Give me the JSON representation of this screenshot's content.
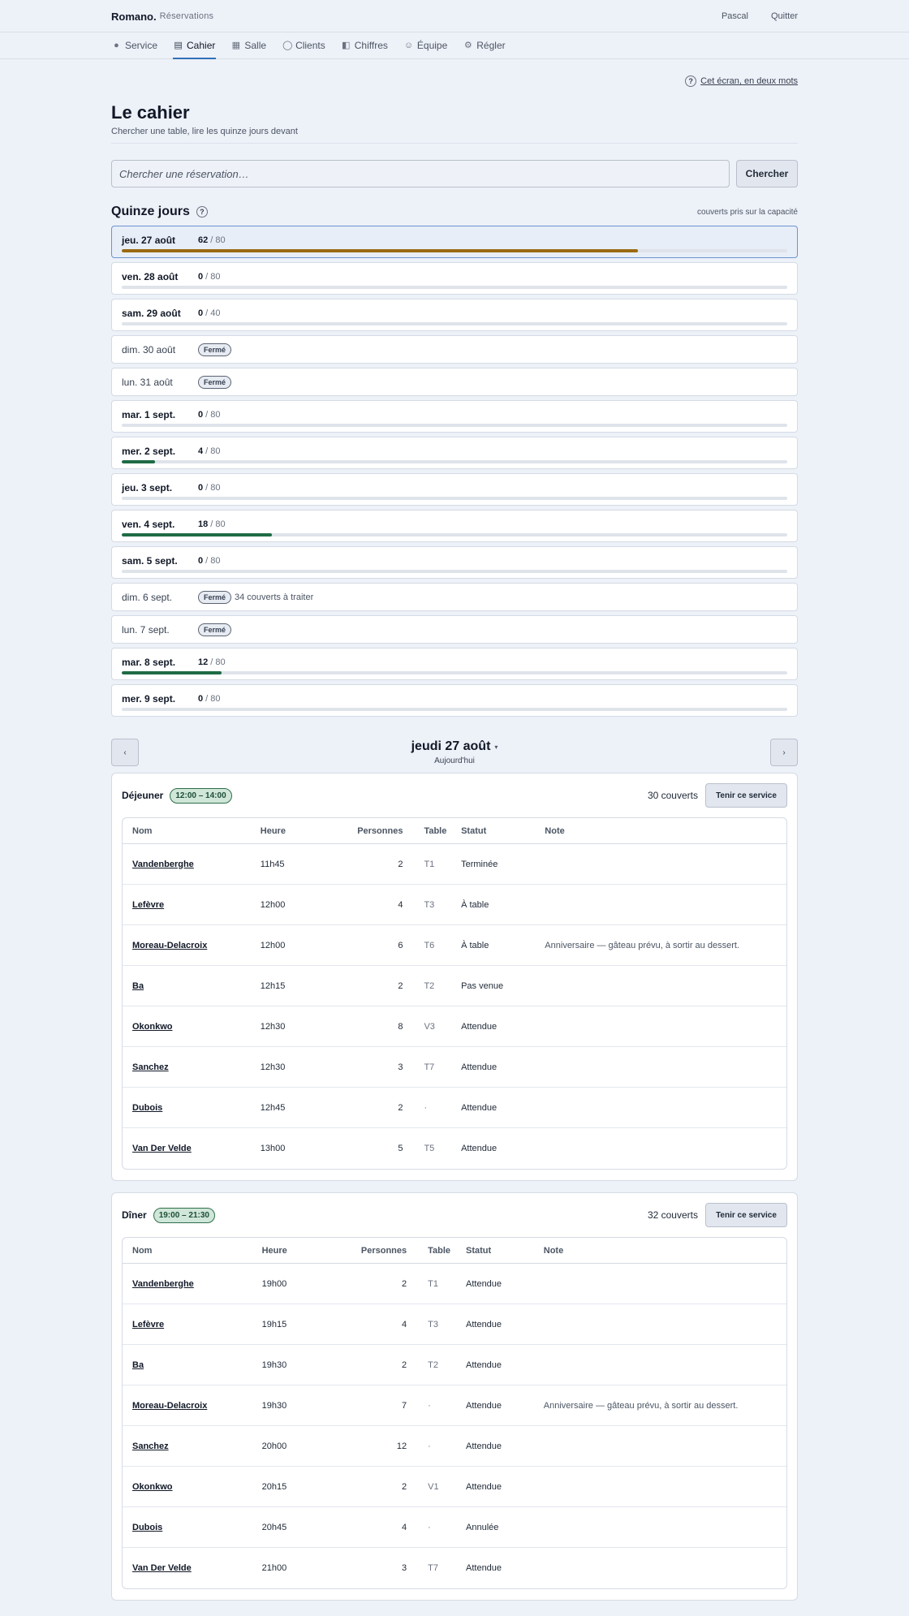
{
  "header": {
    "brand": "Romano.",
    "subtitle": "Réservations",
    "user": "Pascal",
    "logout": "Quitter"
  },
  "nav": [
    {
      "label": "Service",
      "icon": "dot-icon",
      "glyph": "●"
    },
    {
      "label": "Cahier",
      "icon": "book-icon",
      "glyph": "▤"
    },
    {
      "label": "Salle",
      "icon": "grid-icon",
      "glyph": "▦"
    },
    {
      "label": "Clients",
      "icon": "person-icon",
      "glyph": "◯"
    },
    {
      "label": "Chiffres",
      "icon": "chart-icon",
      "glyph": "◧"
    },
    {
      "label": "Équipe",
      "icon": "smile-icon",
      "glyph": "☺"
    },
    {
      "label": "Régler",
      "icon": "gear-icon",
      "glyph": "⚙"
    }
  ],
  "help": {
    "glyph": "?",
    "label": "Cet écran, en deux mots"
  },
  "page": {
    "title": "Le cahier",
    "subtitle": "Chercher une table, lire les quinze jours devant"
  },
  "search": {
    "placeholder": "Chercher une réservation…",
    "value": "",
    "button": "Chercher"
  },
  "fortnight": {
    "title": "Quinze jours",
    "help_glyph": "?",
    "note": "couverts pris sur la capacité",
    "closed_label": "Fermé",
    "days": [
      {
        "label": "jeu. 27 août",
        "covers": 62,
        "capacity": 80,
        "selected": true,
        "color": "#9a6a12"
      },
      {
        "label": "ven. 28 août",
        "covers": 0,
        "capacity": 80
      },
      {
        "label": "sam. 29 août",
        "covers": 0,
        "capacity": 40
      },
      {
        "label": "dim. 30 août",
        "closed": true
      },
      {
        "label": "lun. 31 août",
        "closed": true
      },
      {
        "label": "mar. 1 sept.",
        "covers": 0,
        "capacity": 80
      },
      {
        "label": "mer. 2 sept.",
        "covers": 4,
        "capacity": 80,
        "color": "#1f6b45"
      },
      {
        "label": "jeu. 3 sept.",
        "covers": 0,
        "capacity": 80
      },
      {
        "label": "ven. 4 sept.",
        "covers": 18,
        "capacity": 80,
        "color": "#1f6b45"
      },
      {
        "label": "sam. 5 sept.",
        "covers": 0,
        "capacity": 80
      },
      {
        "label": "dim. 6 sept.",
        "closed": true,
        "extra": "34 couverts à traiter"
      },
      {
        "label": "lun. 7 sept.",
        "closed": true
      },
      {
        "label": "mar. 8 sept.",
        "covers": 12,
        "capacity": 80,
        "color": "#1f6b45"
      },
      {
        "label": "mer. 9 sept.",
        "covers": 0,
        "capacity": 80
      }
    ]
  },
  "date_nav": {
    "prev": "‹",
    "next": "›",
    "title": "jeudi 27 août",
    "caret": "▾",
    "sub": "Aujourd'hui"
  },
  "columns": {
    "name": "Nom",
    "time": "Heure",
    "people": "Personnes",
    "table": "Table",
    "status": "Statut",
    "note": "Note"
  },
  "services": [
    {
      "name": "Déjeuner",
      "hours": "12:00 – 14:00",
      "covers": "30 couverts",
      "button": "Tenir ce service",
      "rows": [
        {
          "name": "Vandenberghe",
          "time": "11h45",
          "people": "2",
          "table": "T1",
          "status": "Terminée",
          "note": ""
        },
        {
          "name": "Lefèvre",
          "time": "12h00",
          "people": "4",
          "table": "T3",
          "status": "À table",
          "note": ""
        },
        {
          "name": "Moreau-Delacroix",
          "time": "12h00",
          "people": "6",
          "table": "T6",
          "status": "À table",
          "note": "Anniversaire — gâteau prévu, à sortir au dessert."
        },
        {
          "name": "Ba",
          "time": "12h15",
          "people": "2",
          "table": "T2",
          "status": "Pas venue",
          "note": ""
        },
        {
          "name": "Okonkwo",
          "time": "12h30",
          "people": "8",
          "table": "V3",
          "status": "Attendue",
          "note": ""
        },
        {
          "name": "Sanchez",
          "time": "12h30",
          "people": "3",
          "table": "T7",
          "status": "Attendue",
          "note": ""
        },
        {
          "name": "Dubois",
          "time": "12h45",
          "people": "2",
          "table": "·",
          "status": "Attendue",
          "note": ""
        },
        {
          "name": "Van Der Velde",
          "time": "13h00",
          "people": "5",
          "table": "T5",
          "status": "Attendue",
          "note": ""
        }
      ]
    },
    {
      "name": "Dîner",
      "hours": "19:00 – 21:30",
      "covers": "32 couverts",
      "button": "Tenir ce service",
      "rows": [
        {
          "name": "Vandenberghe",
          "time": "19h00",
          "people": "2",
          "table": "T1",
          "status": "Attendue",
          "note": ""
        },
        {
          "name": "Lefèvre",
          "time": "19h15",
          "people": "4",
          "table": "T3",
          "status": "Attendue",
          "note": ""
        },
        {
          "name": "Ba",
          "time": "19h30",
          "people": "2",
          "table": "T2",
          "status": "Attendue",
          "note": ""
        },
        {
          "name": "Moreau-Delacroix",
          "time": "19h30",
          "people": "7",
          "table": "·",
          "status": "Attendue",
          "note": "Anniversaire — gâteau prévu, à sortir au dessert."
        },
        {
          "name": "Sanchez",
          "time": "20h00",
          "people": "12",
          "table": "·",
          "status": "Attendue",
          "note": ""
        },
        {
          "name": "Okonkwo",
          "time": "20h15",
          "people": "2",
          "table": "V1",
          "status": "Attendue",
          "note": ""
        },
        {
          "name": "Dubois",
          "time": "20h45",
          "people": "4",
          "table": "·",
          "status": "Annulée",
          "note": ""
        },
        {
          "name": "Van Der Velde",
          "time": "21h00",
          "people": "3",
          "table": "T7",
          "status": "Attendue",
          "note": ""
        }
      ]
    }
  ]
}
